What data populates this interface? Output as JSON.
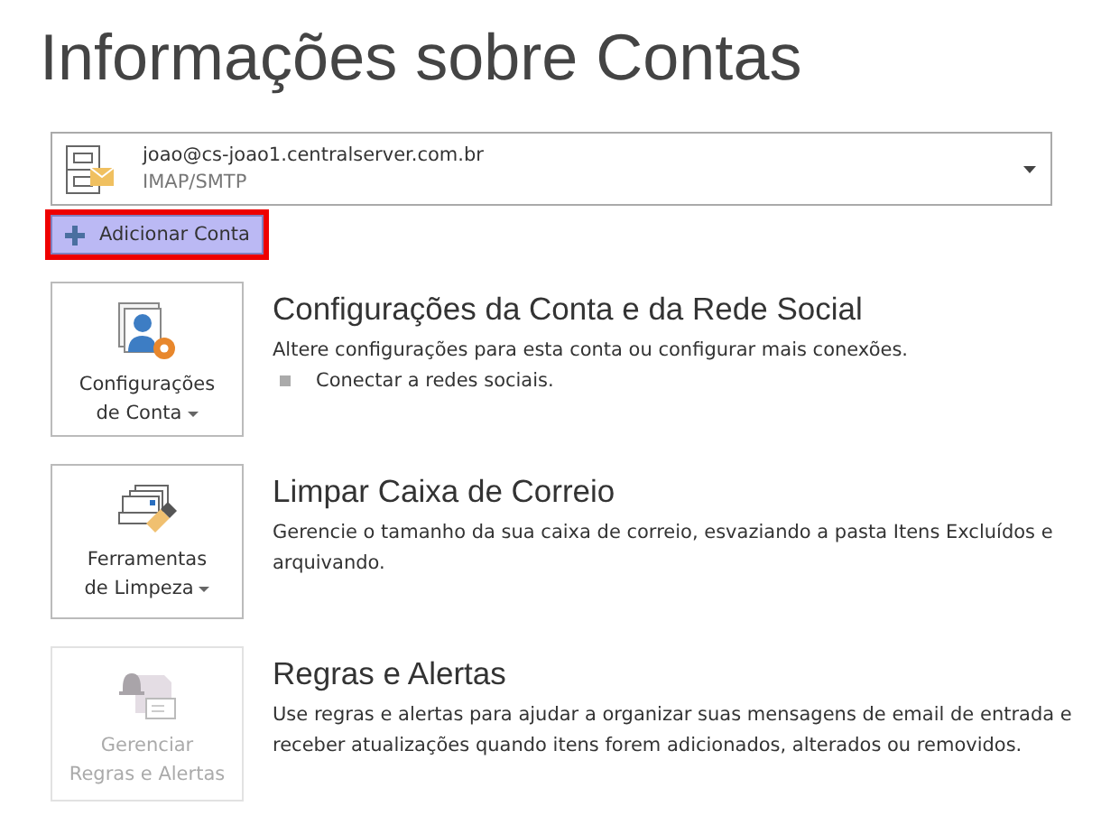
{
  "title": "Informações sobre Contas",
  "account": {
    "email": "joao@cs-joao1.centralserver.com.br",
    "type": "IMAP/SMTP"
  },
  "add_account": {
    "label": "Adicionar Conta",
    "highlighted": true
  },
  "sections": [
    {
      "kind": "settings",
      "button_lines": [
        "Configurações",
        "de Conta"
      ],
      "dropdown": true,
      "disabled": false,
      "heading": "Configurações da Conta e da Rede Social",
      "description": "Altere configurações para esta conta ou configurar mais conexões.",
      "bullets": [
        "Conectar a redes sociais."
      ]
    },
    {
      "kind": "cleanup",
      "button_lines": [
        "Ferramentas",
        "de Limpeza"
      ],
      "dropdown": true,
      "disabled": false,
      "heading": "Limpar Caixa de Correio",
      "description": "Gerencie o tamanho da sua caixa de correio, esvaziando a pasta Itens Excluídos e arquivando."
    },
    {
      "kind": "rules",
      "button_lines": [
        "Gerenciar",
        "Regras e Alertas"
      ],
      "dropdown": false,
      "disabled": true,
      "heading": "Regras e Alertas",
      "description": "Use regras e alertas para ajudar a organizar suas mensagens de email de entrada e receber atualizações quando itens forem adicionados, alterados ou removidos."
    }
  ]
}
